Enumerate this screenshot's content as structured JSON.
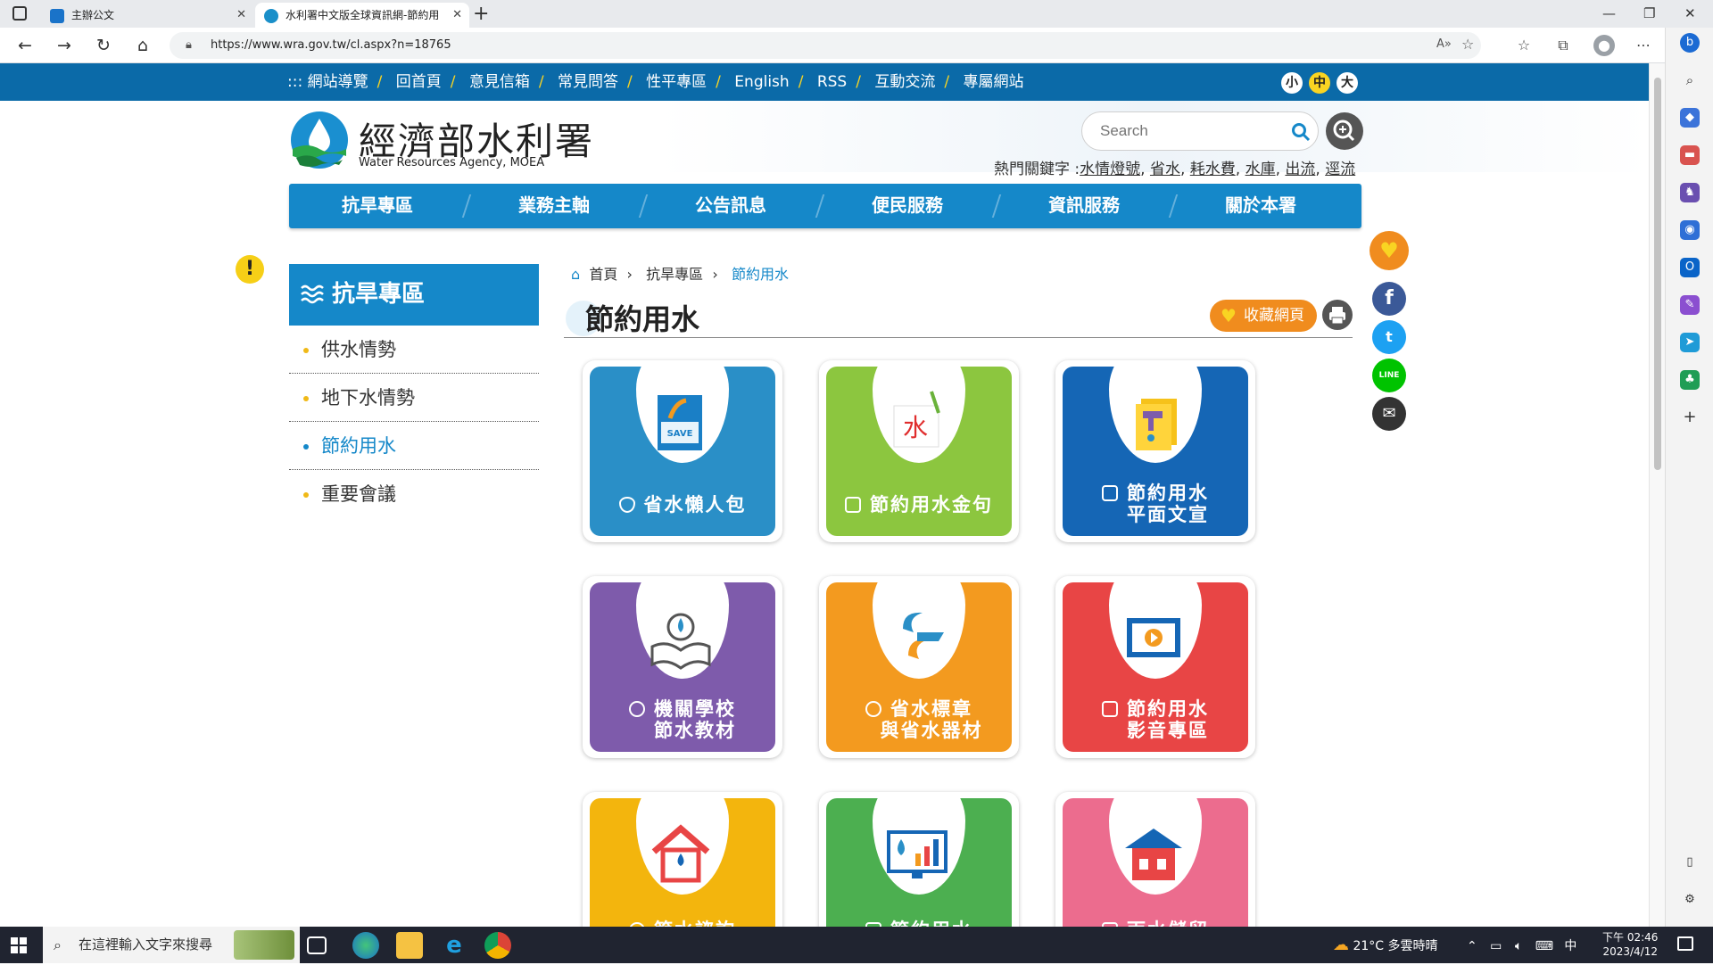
{
  "browser": {
    "tabs": [
      {
        "title": "主辦公文",
        "active": false
      },
      {
        "title": "水利署中文版全球資訊網-節約用",
        "active": true
      }
    ],
    "url": "https://www.wra.gov.tw/cl.aspx?n=18765"
  },
  "site": {
    "top_links": [
      "::: 網站導覽",
      "回首頁",
      "意見信箱",
      "常見問答",
      "性平專區",
      "English",
      "RSS",
      "互動交流",
      "專屬網站"
    ],
    "font_sizes": [
      "小",
      "中",
      "大"
    ],
    "logo_title": "經濟部水利署",
    "logo_subtitle": "Water Resources Agency, MOEA",
    "search_placeholder": "Search",
    "hot_keywords_label": "熱門關鍵字 :",
    "hot_keywords": [
      "水情燈號",
      "省水",
      "耗水費",
      "水庫",
      "出流",
      "逕流"
    ],
    "main_nav": [
      "抗旱專區",
      "業務主軸",
      "公告訊息",
      "便民服務",
      "資訊服務",
      "關於本署"
    ]
  },
  "sidebar": {
    "title": "抗旱專區",
    "items": [
      {
        "label": "供水情勢",
        "active": false
      },
      {
        "label": "地下水情勢",
        "active": false
      },
      {
        "label": "節約用水",
        "active": true
      },
      {
        "label": "重要會議",
        "active": false
      }
    ]
  },
  "content": {
    "breadcrumb": [
      "首頁",
      "抗旱專區",
      "節約用水"
    ],
    "title": "節約用水",
    "favorite_label": "收藏網頁",
    "tiles": [
      {
        "line1": "省水懶人包",
        "line2": "",
        "color": "#2a8fc7",
        "art": "SAVE"
      },
      {
        "line1": "節約用水金句",
        "line2": "",
        "color": "#8cc63f",
        "art": "水"
      },
      {
        "line1": "節約用水",
        "line2": "平面文宣",
        "color": "#1566b5",
        "art": ""
      },
      {
        "line1": "機關學校",
        "line2": "節水教材",
        "color": "#7e5bab",
        "art": ""
      },
      {
        "line1": "省水標章",
        "line2": "與省水器材",
        "color": "#f39a1f",
        "art": ""
      },
      {
        "line1": "節約用水",
        "line2": "影音專區",
        "color": "#e84545",
        "art": ""
      },
      {
        "line1": "節水諮詢",
        "line2": "",
        "color": "#f3b50d",
        "art": ""
      },
      {
        "line1": "節約用水",
        "line2": "",
        "color": "#4caf50",
        "art": ""
      },
      {
        "line1": "雨水儲留",
        "line2": "",
        "color": "#ec6c8e",
        "art": ""
      }
    ]
  },
  "taskbar": {
    "search_placeholder": "在這裡輸入文字來搜尋",
    "weather": "21°C 多雲時晴",
    "ime": "中",
    "time": "下午 02:46",
    "date": "2023/4/12"
  },
  "colors": {
    "brand_blue": "#1588c9",
    "topbar": "#0b6aa8",
    "accent_yellow": "#f9d422"
  }
}
